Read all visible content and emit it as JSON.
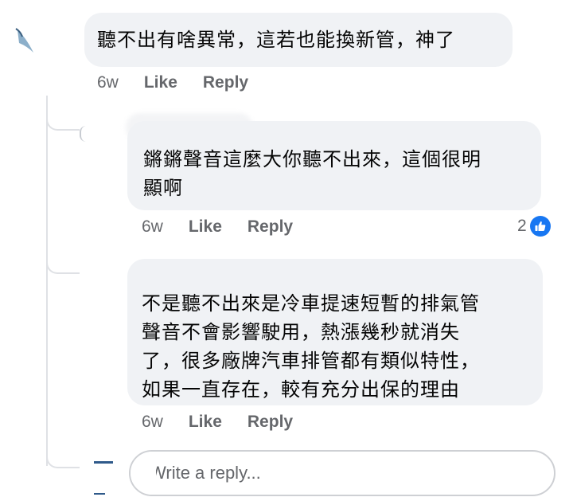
{
  "comments": [
    {
      "text": "聽不出有啥異常，這若也能換新管，神了",
      "time": "6w",
      "like_label": "Like",
      "reply_label": "Reply"
    },
    {
      "text": "鏘鏘聲音這麼大你聽不出來，這個很明\n顯啊",
      "time": "6w",
      "like_label": "Like",
      "reply_label": "Reply",
      "reaction_count": "2"
    },
    {
      "text": "不是聽不出來是冷車提速短暫的排氣管\n聲音不會影響駛用，熱漲幾秒就消失\n了，很多廠牌汽車排管都有類似特性，\n如果一直存在，較有充分出保的理由",
      "time": "6w",
      "like_label": "Like",
      "reply_label": "Reply"
    }
  ],
  "reply_input": {
    "placeholder": "Write a reply..."
  },
  "colors": {
    "bubble": "#f0f2f5",
    "meta_text": "#65676b",
    "like_blue": "#1877f2",
    "thread_line": "#dfe1e5"
  },
  "icons": {
    "reaction": "thumbs-up-icon"
  }
}
